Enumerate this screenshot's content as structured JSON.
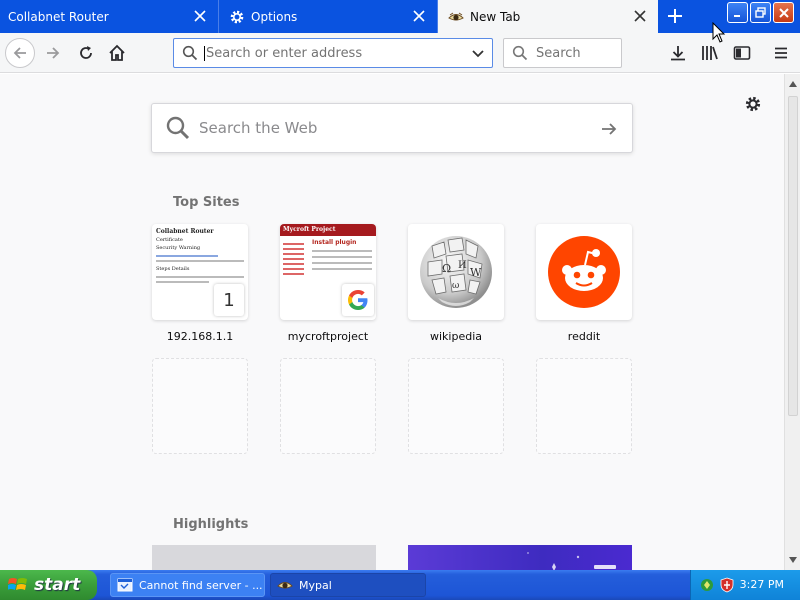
{
  "tabs": [
    {
      "label": "Collabnet Router"
    },
    {
      "label": "Options"
    },
    {
      "label": "New Tab"
    }
  ],
  "navbar": {
    "url_placeholder": "Search or enter address",
    "search_placeholder": "Search"
  },
  "content": {
    "web_search_placeholder": "Search the Web",
    "top_sites_title": "Top Sites",
    "highlights_title": "Highlights",
    "top_sites": [
      {
        "label": "192.168.1.1",
        "badge": "1"
      },
      {
        "label": "mycroftproject"
      },
      {
        "label": "wikipedia"
      },
      {
        "label": "reddit"
      }
    ],
    "thumb_router": {
      "title": "Collabnet Router",
      "subtitle": "Certificate",
      "section1": "Security Warning",
      "section2": "Steps Details"
    },
    "thumb_mycroft": {
      "header": "Mycroft Project",
      "heading": "Install plugin"
    }
  },
  "taskbar": {
    "start_label": "start",
    "tasks": [
      {
        "label": "Cannot find server - ..."
      },
      {
        "label": "Mypal"
      }
    ],
    "clock": "3:27 PM"
  },
  "colors": {
    "tabbar": "#0a53e0",
    "active_tab": "#f5f6f7",
    "reddit": "#ff4500",
    "taskbar": "#245edb",
    "start_button": "#3a9e3a"
  }
}
